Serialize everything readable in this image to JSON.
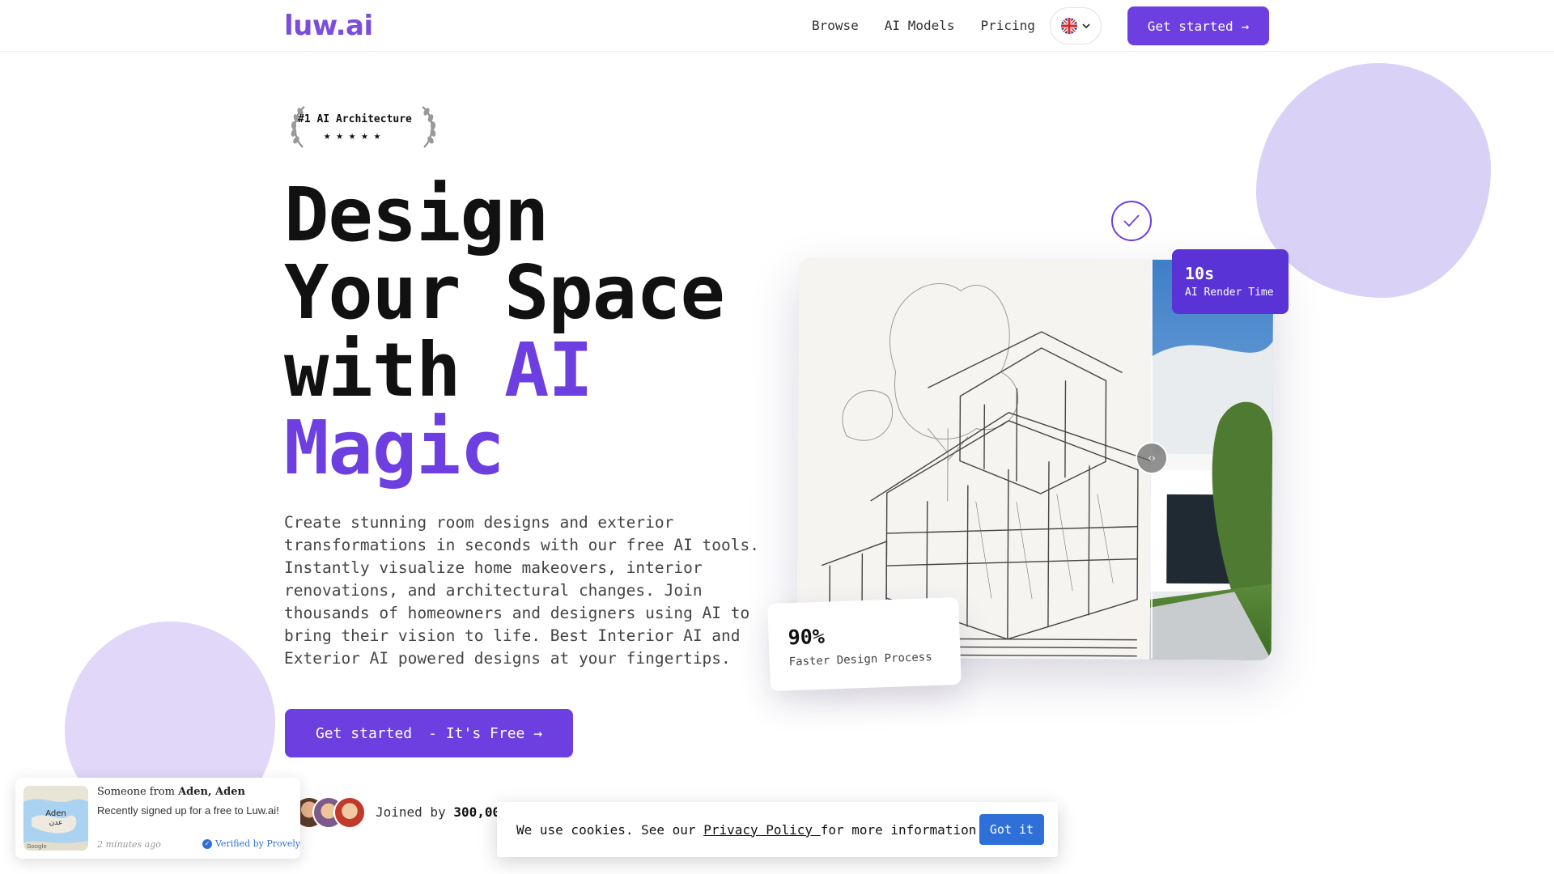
{
  "header": {
    "logo": "luw.ai",
    "nav": [
      "Browse",
      "AI Models",
      "Pricing"
    ],
    "language_icon": "uk-flag-icon",
    "cta_label": "Get started",
    "cta_arrow": "→"
  },
  "badge": {
    "title": "#1 AI Architecture",
    "stars": "★★★★★",
    "rating": 5
  },
  "hero": {
    "line1": "Design",
    "line2": "Your Space",
    "line3_plain": "with ",
    "line3_accent": "AI",
    "line4_accent": "Magic",
    "description": "Create stunning room designs and exterior transformations in seconds with our free AI tools. Instantly visualize home makeovers, interior renovations, and architectural changes. Join thousands of homeowners and designers using AI to bring their vision to life. Best Interior AI and Exterior AI powered designs at your fingertips.",
    "cta_main": "Get started",
    "cta_sub": "- It's Free",
    "cta_arrow": "→",
    "joined_prefix": "Joined by ",
    "joined_count": "300,000"
  },
  "stats": {
    "render_value": "10s",
    "render_label": "AI Render Time",
    "faster_value": "90%",
    "faster_label": "Faster Design Process"
  },
  "compare_slider": {
    "handle_icon": "‹›",
    "position": 0.61
  },
  "cookie": {
    "text_before": "We use cookies. See our ",
    "link": "Privacy Policy ",
    "text_after": "for more information.",
    "button": "Got it"
  },
  "notification": {
    "title_prefix": "Someone from ",
    "location": "Aden, Aden",
    "message": "Recently signed up for a free to Luw.ai!",
    "time": "2 minutes ago",
    "verified": "Verified by Provely",
    "map_label": "Aden",
    "map_label_ar": "عدن",
    "map_brand": "Google"
  },
  "colors": {
    "accent": "#6d3fe0",
    "blob": "#d6ccf6",
    "cookie_button": "#2f6fd8"
  }
}
